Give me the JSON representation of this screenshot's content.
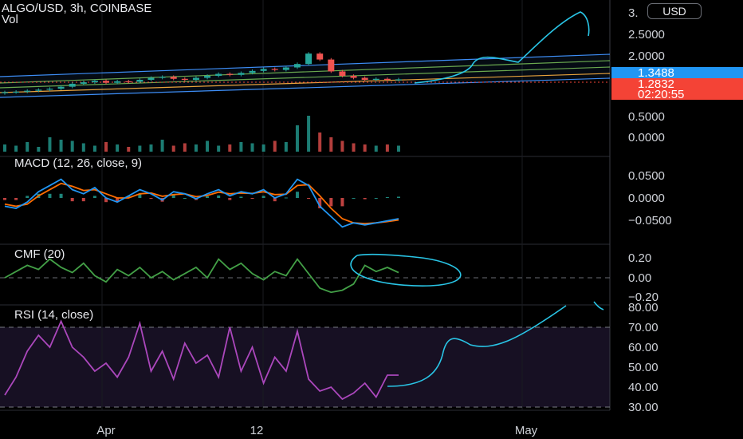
{
  "header": {
    "symbol_title": "ALGO/USD, 3h, COINBASE",
    "volume_label": "Vol",
    "currency_button": "USD"
  },
  "colors": {
    "bull": "#26a69a",
    "bear": "#ef5350",
    "channel": "#3d8df5",
    "macd": "#2196f3",
    "signal": "#ff6d00",
    "cmf": "#43a047",
    "rsi": "#ab47bc",
    "drawing": "#29c5e6",
    "last_price_badge": "#2196f3",
    "current_price_badge": "#f44336"
  },
  "chart_data": [
    {
      "type": "candlestick",
      "pane": "price",
      "title": "ALGO/USD, 3h, COINBASE",
      "y_ticks": [
        "3.",
        "2.5000",
        "2.0000",
        "0.5000",
        "0.0000"
      ],
      "x_ticks": [
        "Apr",
        "12",
        "May"
      ],
      "price_badges": [
        {
          "label": "1.3488",
          "value": 1.3488,
          "role": "last_price"
        },
        {
          "label": "1.2832",
          "value": 1.2832,
          "role": "current_price"
        },
        {
          "label": "02:20:55",
          "role": "countdown"
        }
      ],
      "series": [
        {
          "name": "close",
          "values": [
            1.05,
            1.06,
            1.08,
            1.1,
            1.12,
            1.16,
            1.22,
            1.25,
            1.28,
            1.24,
            1.27,
            1.26,
            1.3,
            1.34,
            1.36,
            1.32,
            1.3,
            1.34,
            1.38,
            1.42,
            1.4,
            1.44,
            1.48,
            1.52,
            1.5,
            1.55,
            1.62,
            1.83,
            1.71,
            1.47,
            1.38,
            1.34,
            1.3,
            1.32,
            1.3,
            1.31
          ]
        }
      ]
    },
    {
      "type": "bar",
      "pane": "volume",
      "title": "Vol",
      "values": [
        0.06,
        0.05,
        0.08,
        0.04,
        0.12,
        0.1,
        0.09,
        0.07,
        0.05,
        0.08,
        0.06,
        0.04,
        0.05,
        0.06,
        0.1,
        0.05,
        0.07,
        0.06,
        0.09,
        0.05,
        0.06,
        0.08,
        0.07,
        0.06,
        0.09,
        0.08,
        0.22,
        0.3,
        0.16,
        0.12,
        0.09,
        0.07,
        0.06,
        0.05,
        0.06,
        0.05
      ]
    },
    {
      "type": "line",
      "pane": "macd",
      "title": "MACD (12, 26, close, 9)",
      "y_ticks": [
        "0.0500",
        "0.0000",
        "−0.0500"
      ],
      "series": [
        {
          "name": "macd",
          "values": [
            -0.02,
            -0.025,
            -0.01,
            0.015,
            0.03,
            0.045,
            0.02,
            0.01,
            0.025,
            0.0,
            -0.01,
            0.005,
            0.02,
            0.01,
            -0.005,
            0.015,
            0.01,
            -0.002,
            0.01,
            0.02,
            0.005,
            0.015,
            0.01,
            0.02,
            0.0,
            0.01,
            0.045,
            0.03,
            -0.02,
            -0.045,
            -0.07,
            -0.06,
            -0.065,
            -0.06,
            -0.055,
            -0.05
          ]
        },
        {
          "name": "signal",
          "values": [
            -0.015,
            -0.02,
            -0.015,
            0.005,
            0.02,
            0.035,
            0.028,
            0.018,
            0.02,
            0.01,
            0.0,
            0.0,
            0.01,
            0.012,
            0.004,
            0.008,
            0.01,
            0.003,
            0.006,
            0.014,
            0.01,
            0.012,
            0.011,
            0.015,
            0.008,
            0.009,
            0.03,
            0.032,
            0.005,
            -0.025,
            -0.05,
            -0.06,
            -0.062,
            -0.06,
            -0.057,
            -0.053
          ]
        }
      ]
    },
    {
      "type": "line",
      "pane": "cmf",
      "title": "CMF (20)",
      "y_ticks": [
        "0.20",
        "0.00",
        "−0.20"
      ],
      "series": [
        {
          "name": "cmf",
          "values": [
            0.0,
            0.06,
            0.12,
            0.08,
            0.18,
            0.1,
            0.05,
            0.14,
            0.02,
            -0.04,
            0.08,
            0.02,
            0.1,
            0.0,
            0.06,
            -0.02,
            0.04,
            0.1,
            0.0,
            0.18,
            0.08,
            0.14,
            0.04,
            -0.02,
            0.06,
            0.02,
            0.18,
            0.04,
            -0.1,
            -0.14,
            -0.12,
            -0.06,
            0.12,
            0.06,
            0.1,
            0.05
          ]
        }
      ]
    },
    {
      "type": "line",
      "pane": "rsi",
      "title": "RSI (14, close)",
      "y_ticks": [
        "80.00",
        "70.00",
        "60.00",
        "50.00",
        "40.00",
        "30.00"
      ],
      "band": [
        30,
        70
      ],
      "series": [
        {
          "name": "rsi",
          "values": [
            36,
            45,
            58,
            66,
            60,
            73,
            60,
            55,
            48,
            52,
            45,
            55,
            72,
            48,
            58,
            44,
            62,
            52,
            56,
            45,
            70,
            48,
            60,
            42,
            55,
            48,
            68,
            44,
            38,
            40,
            34,
            37,
            42,
            35,
            46,
            46
          ]
        }
      ]
    }
  ]
}
